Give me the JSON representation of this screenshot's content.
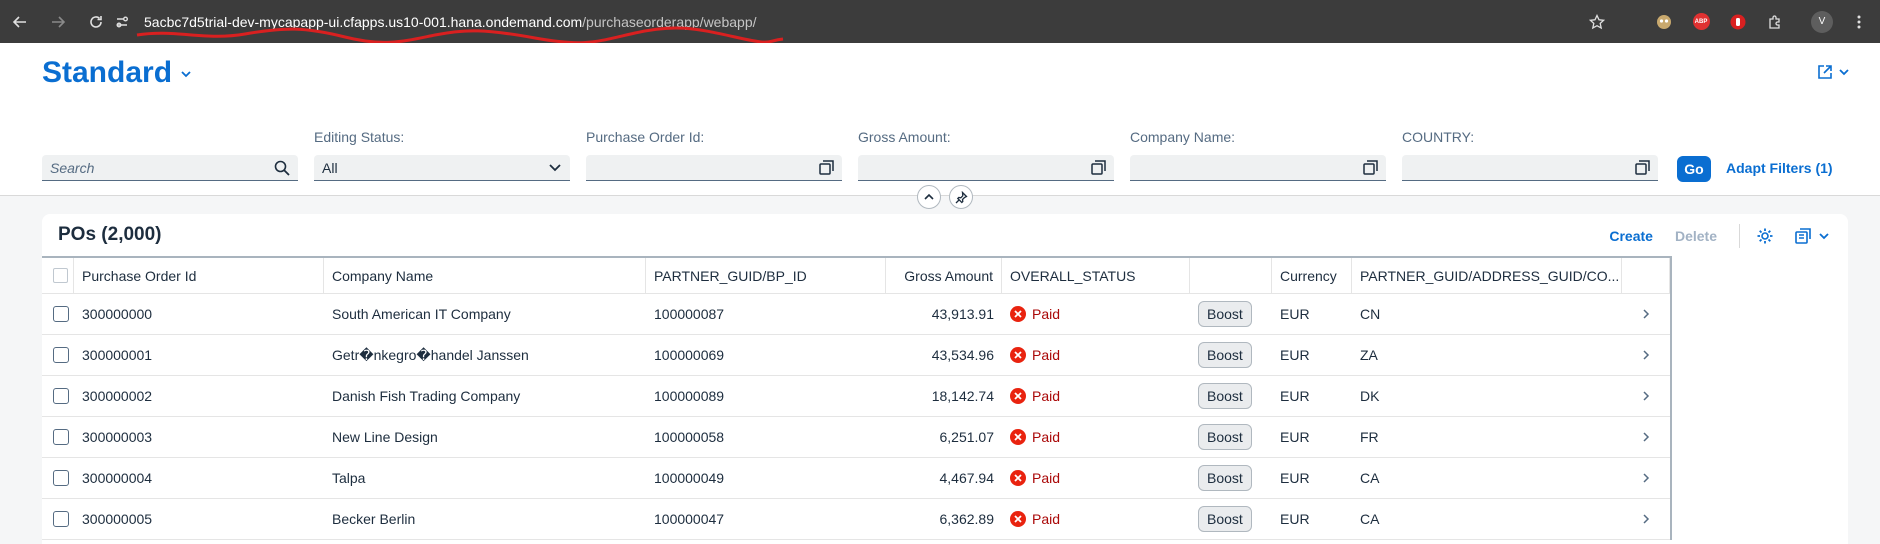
{
  "browser": {
    "url_host": "5acbc7d5trial-dev-mycapapp-ui.cfapps.us10-001.hana.ondemand.com",
    "url_path": "/purchaseorderapp/webapp/",
    "profile_initial": "V",
    "abp_label": "ABP"
  },
  "header": {
    "variant_title": "Standard"
  },
  "filters": {
    "search": {
      "placeholder": "Search"
    },
    "editing_status": {
      "label": "Editing Status:",
      "value": "All"
    },
    "purchase_order_id": {
      "label": "Purchase Order Id:",
      "value": ""
    },
    "gross_amount": {
      "label": "Gross Amount:",
      "value": ""
    },
    "company_name": {
      "label": "Company Name:",
      "value": ""
    },
    "country": {
      "label": "COUNTRY:",
      "value": ""
    },
    "go_label": "Go",
    "adapt_label": "Adapt Filters (1)"
  },
  "table": {
    "title": "POs (2,000)",
    "create_label": "Create",
    "delete_label": "Delete",
    "columns": {
      "po_id": "Purchase Order Id",
      "company": "Company Name",
      "bp_id": "PARTNER_GUID/BP_ID",
      "gross": "Gross Amount",
      "status": "OVERALL_STATUS",
      "boost": "",
      "currency": "Currency",
      "country": "PARTNER_GUID/ADDRESS_GUID/CO..."
    },
    "rows": [
      {
        "po_id": "300000000",
        "company": "South American IT Company",
        "bp_id": "100000087",
        "gross": "43,913.91",
        "status": "Paid",
        "boost": "Boost",
        "currency": "EUR",
        "country": "CN"
      },
      {
        "po_id": "300000001",
        "company": "Getr�nkegro�handel Janssen",
        "bp_id": "100000069",
        "gross": "43,534.96",
        "status": "Paid",
        "boost": "Boost",
        "currency": "EUR",
        "country": "ZA"
      },
      {
        "po_id": "300000002",
        "company": "Danish Fish Trading Company",
        "bp_id": "100000089",
        "gross": "18,142.74",
        "status": "Paid",
        "boost": "Boost",
        "currency": "EUR",
        "country": "DK"
      },
      {
        "po_id": "300000003",
        "company": "New Line Design",
        "bp_id": "100000058",
        "gross": "6,251.07",
        "status": "Paid",
        "boost": "Boost",
        "currency": "EUR",
        "country": "FR"
      },
      {
        "po_id": "300000004",
        "company": "Talpa",
        "bp_id": "100000049",
        "gross": "4,467.94",
        "status": "Paid",
        "boost": "Boost",
        "currency": "EUR",
        "country": "CA"
      },
      {
        "po_id": "300000005",
        "company": "Becker Berlin",
        "bp_id": "100000047",
        "gross": "6,362.89",
        "status": "Paid",
        "boost": "Boost",
        "currency": "EUR",
        "country": "CA"
      }
    ]
  },
  "colors": {
    "accent": "#0a6ed1",
    "error": "#aa0808",
    "chrome": "#3c3c3c"
  }
}
